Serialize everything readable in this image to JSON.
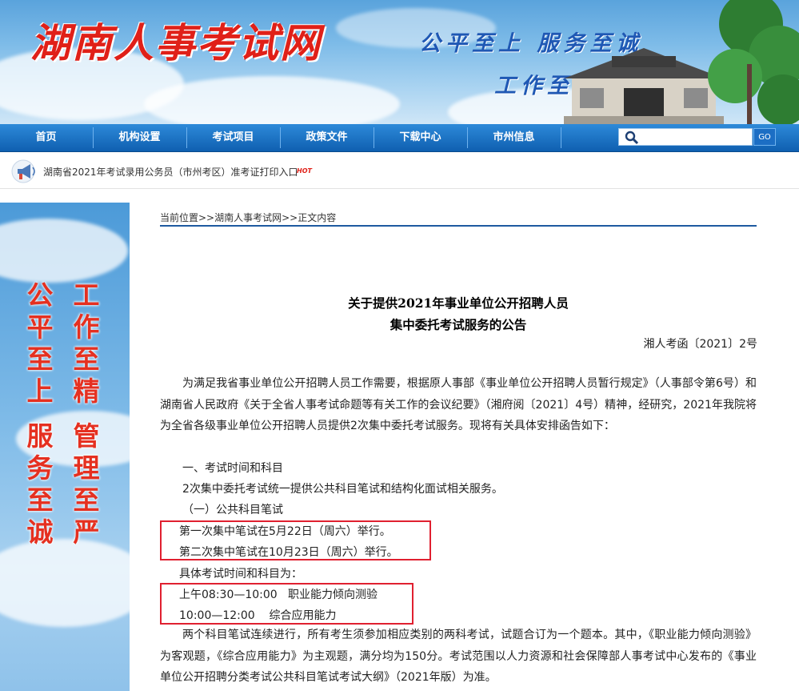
{
  "header": {
    "site_title": "湖南人事考试网",
    "slogan_line1": "公平至上 服务至诚",
    "slogan_line2": "工作至精 管理至严"
  },
  "nav": {
    "items": [
      {
        "label": "首页"
      },
      {
        "label": "机构设置"
      },
      {
        "label": "考试项目"
      },
      {
        "label": "政策文件"
      },
      {
        "label": "下载中心"
      },
      {
        "label": "市州信息"
      }
    ],
    "search_value": "",
    "go_label": "GO"
  },
  "notice": {
    "text": "湖南省2021年考试录用公务员（市州考区）准考证打印入口",
    "badge": "HOT"
  },
  "side_banner": {
    "col1": [
      "公",
      "平",
      "至",
      "上",
      "",
      "服",
      "务",
      "至",
      "诚"
    ],
    "col2": [
      "工",
      "作",
      "至",
      "精",
      "",
      "管",
      "理",
      "至",
      "严"
    ]
  },
  "breadcrumb": "当前位置>>湖南人事考试网>>正文内容",
  "article": {
    "title_line1": "关于提供2021年事业单位公开招聘人员",
    "title_line2": "集中委托考试服务的公告",
    "doc_number": "湘人考函〔2021〕2号",
    "intro": "为满足我省事业单位公开招聘人员工作需要，根据原人事部《事业单位公开招聘人员暂行规定》（人事部令第6号）和湖南省人民政府《关于全省人事考试命题等有关工作的会议纪要》（湘府阅〔2021〕4号）精神，经研究，2021年我院将为全省各级事业单位公开招聘人员提供2次集中委托考试服务。现将有关具体安排函告如下：",
    "section1": "一、考试时间和科目",
    "section1_desc": "2次集中委托考试统一提供公共科目笔试和结构化面试相关服务。",
    "subsection1": "（一）公共科目笔试",
    "exam1": "第一次集中笔试在5月22日（周六）举行。",
    "exam2": "第二次集中笔试在10月23日（周六）举行。",
    "schedule_intro": "具体考试时间和科目为：",
    "schedule1": "上午08:30—10:00   职业能力倾向测验",
    "schedule2": "10:00—12:00    综合应用能力",
    "detail": "两个科目笔试连续进行，所有考生须参加相应类别的两科考试，试题合订为一个题本。其中，《职业能力倾向测验》为客观题，《综合应用能力》为主观题，满分均为150分。考试范围以人力资源和社会保障部人事考试中心发布的《事业单位公开招聘分类考试公共科目笔试考试大纲》（2021年版）为准。"
  },
  "colors": {
    "nav_blue": "#0f5fb0",
    "logo_red": "#e02018",
    "slogan_blue": "#1f58b4",
    "highlight_red": "#e02030"
  }
}
